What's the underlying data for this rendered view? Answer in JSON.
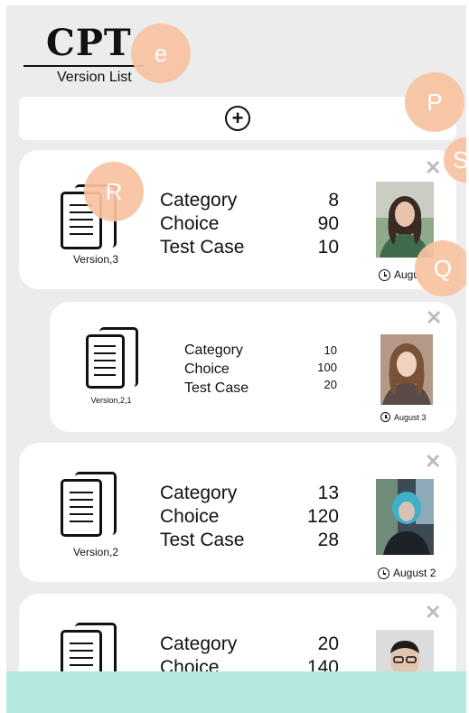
{
  "header": {
    "logo": "CPT",
    "subtitle": "Version List"
  },
  "annotations": {
    "e": "e",
    "P": "P",
    "S": "S",
    "R": "R",
    "Q": "Q"
  },
  "add_button": {
    "label": "+"
  },
  "versions": [
    {
      "version_label": "Version,3",
      "stats": [
        {
          "label": "Category",
          "value": "8"
        },
        {
          "label": "Choice",
          "value": "90"
        },
        {
          "label": "Test Case",
          "value": "10"
        }
      ],
      "date": "Augu",
      "close_label": "✕"
    },
    {
      "version_label": "Version,2,1",
      "stats": [
        {
          "label": "Category",
          "value": "10"
        },
        {
          "label": "Choice",
          "value": "100"
        },
        {
          "label": "Test Case",
          "value": "20"
        }
      ],
      "date": "August 3",
      "close_label": "✕"
    },
    {
      "version_label": "Version,2",
      "stats": [
        {
          "label": "Category",
          "value": "13"
        },
        {
          "label": "Choice",
          "value": "120"
        },
        {
          "label": "Test Case",
          "value": "28"
        }
      ],
      "date": "August 2",
      "close_label": "✕"
    },
    {
      "version_label": "",
      "stats": [
        {
          "label": "Category",
          "value": "20"
        },
        {
          "label": "Choice",
          "value": "140"
        }
      ],
      "date": "",
      "close_label": "✕"
    }
  ],
  "colors": {
    "background": "#ececec",
    "card": "#ffffff",
    "bubble": "#f7c3a1",
    "bottom_bar": "#b5e8de"
  }
}
